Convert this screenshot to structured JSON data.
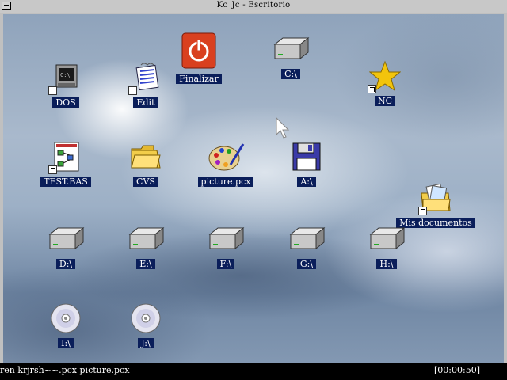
{
  "window": {
    "title": "Kc_Jc  -  Escritorio"
  },
  "desktop": {
    "icons": [
      {
        "label": "DOS",
        "icon": "dos-window-icon",
        "shortcut": true
      },
      {
        "label": "Edit",
        "icon": "edit-notepad-icon",
        "shortcut": true
      },
      {
        "label": "Finalizar",
        "icon": "power-off-icon",
        "shortcut": false
      },
      {
        "label": "C:\\",
        "icon": "hard-drive-icon",
        "shortcut": false
      },
      {
        "label": "NC",
        "icon": "star-icon",
        "shortcut": true
      },
      {
        "label": "TEST.BAS",
        "icon": "flowchart-icon",
        "shortcut": true
      },
      {
        "label": "CVS",
        "icon": "folder-icon",
        "shortcut": false
      },
      {
        "label": "picture.pcx",
        "icon": "paint-palette-icon",
        "shortcut": false
      },
      {
        "label": "A:\\",
        "icon": "floppy-disk-icon",
        "shortcut": false
      },
      {
        "label": "Mis documentos",
        "icon": "documents-folder-icon",
        "shortcut": true
      },
      {
        "label": "D:\\",
        "icon": "hard-drive-icon",
        "shortcut": false
      },
      {
        "label": "E:\\",
        "icon": "hard-drive-icon",
        "shortcut": false
      },
      {
        "label": "F:\\",
        "icon": "hard-drive-icon",
        "shortcut": false
      },
      {
        "label": "G:\\",
        "icon": "hard-drive-icon",
        "shortcut": false
      },
      {
        "label": "H:\\",
        "icon": "hard-drive-icon",
        "shortcut": false
      },
      {
        "label": "I:\\",
        "icon": "cd-rom-icon",
        "shortcut": false
      },
      {
        "label": "J:\\",
        "icon": "cd-rom-icon",
        "shortcut": false
      }
    ]
  },
  "statusbar": {
    "text": "ren  krjrsh~~.pcx  picture.pcx",
    "clock": "[00:00:50]"
  },
  "colors": {
    "label_bg": "#0a1e5a",
    "label_fg": "#ffffff",
    "titlebar": "#c8c8c8",
    "statusbar": "#000000"
  }
}
